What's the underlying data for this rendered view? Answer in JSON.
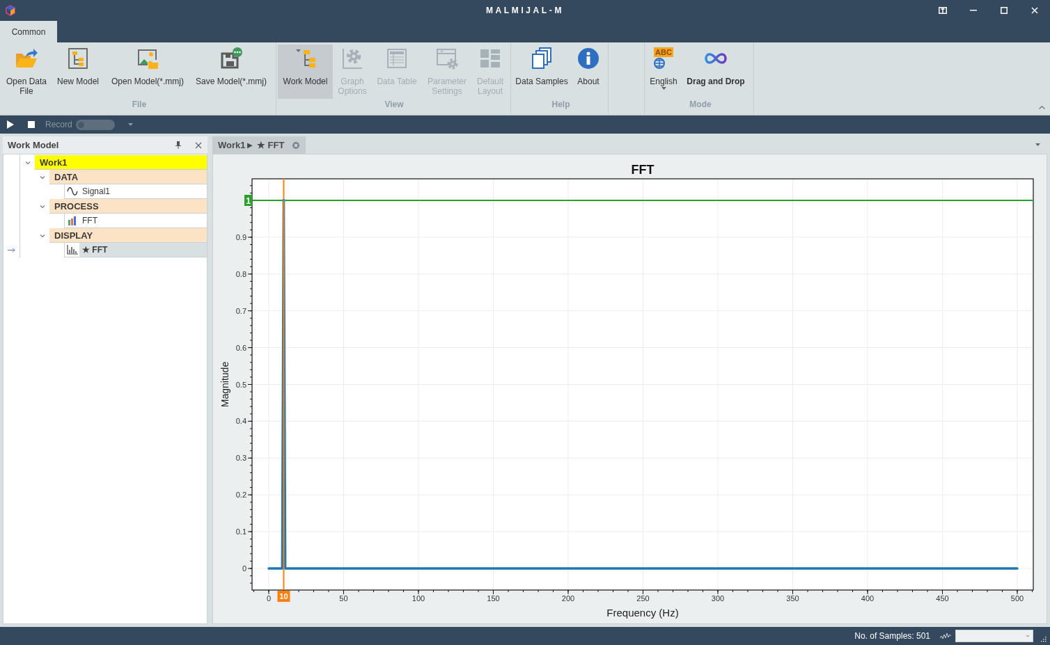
{
  "window": {
    "title": "MALMIJAL-M"
  },
  "ribbon": {
    "tabs": [
      {
        "label": "Common",
        "selected": true
      }
    ],
    "groups": [
      {
        "label": "File",
        "buttons": [
          {
            "label": "Open Data File",
            "disabled": false,
            "pressed": false,
            "active": false
          },
          {
            "label": "New Model",
            "disabled": false,
            "pressed": false,
            "active": false
          },
          {
            "label": "Open Model(*.mmj)",
            "disabled": false,
            "pressed": false,
            "active": false
          },
          {
            "label": "Save Model(*.mmj)",
            "disabled": false,
            "pressed": false,
            "active": false
          }
        ]
      },
      {
        "label": "View",
        "buttons": [
          {
            "label": "Work Model",
            "disabled": false,
            "pressed": true,
            "active": false
          },
          {
            "label": "Graph Options",
            "disabled": true,
            "pressed": false,
            "active": false
          },
          {
            "label": "Data Table",
            "disabled": true,
            "pressed": false,
            "active": false
          },
          {
            "label": "Parameter Settings",
            "disabled": true,
            "pressed": false,
            "active": false
          },
          {
            "label": "Default Layout",
            "disabled": true,
            "pressed": false,
            "active": false
          }
        ]
      },
      {
        "label": "Help",
        "buttons": [
          {
            "label": "Data Samples",
            "disabled": false,
            "pressed": false,
            "active": false
          },
          {
            "label": "About",
            "disabled": false,
            "pressed": false,
            "active": false
          }
        ]
      },
      {
        "label": "Mode",
        "buttons": [
          {
            "label": "English",
            "disabled": false,
            "pressed": false,
            "active": false,
            "badge": "ABC",
            "menu": true
          },
          {
            "label": "Drag and Drop",
            "disabled": false,
            "pressed": false,
            "active": true
          }
        ]
      }
    ]
  },
  "toolbar": {
    "record": {
      "label": "Record",
      "disabled": true
    },
    "record_toggle": {
      "on": false
    }
  },
  "work_model_panel": {
    "title": "Work Model",
    "tree": [
      {
        "label": "Work1",
        "kind": "root",
        "expanded": true,
        "selected": false,
        "children": [
          {
            "label": "DATA",
            "kind": "category",
            "expanded": true,
            "selected": false,
            "children": [
              {
                "label": "Signal1",
                "kind": "signal",
                "selected": false
              }
            ]
          },
          {
            "label": "PROCESS",
            "kind": "category",
            "expanded": true,
            "selected": false,
            "children": [
              {
                "label": "FFT",
                "kind": "process",
                "selected": false
              }
            ]
          },
          {
            "label": "DISPLAY",
            "kind": "category",
            "expanded": true,
            "selected": false,
            "children": [
              {
                "label": "★ FFT",
                "kind": "display",
                "selected": true
              }
            ]
          }
        ]
      }
    ]
  },
  "document_tabs": [
    {
      "label": "Work1► ★ FFT",
      "selected": true
    }
  ],
  "chart": {
    "chart_data": {
      "type": "line",
      "title": "FFT",
      "xlabel": "Frequency (Hz)",
      "ylabel": "Magnitude",
      "x": [
        0,
        9,
        10,
        11,
        500
      ],
      "series": [
        {
          "color": "#1f77b4",
          "values": [
            0,
            0,
            1,
            0,
            0
          ]
        }
      ],
      "xlim": [
        -11.16,
        510.7
      ],
      "ylim": [
        -0.0586,
        1.0586
      ],
      "xticks": [
        0,
        50,
        100,
        150,
        200,
        250,
        300,
        350,
        400,
        450,
        500
      ],
      "yticks": [
        0,
        0.1,
        0.2,
        0.3,
        0.4,
        0.5,
        0.6,
        0.7,
        0.8,
        0.9
      ],
      "grid": true,
      "ref_lines": [
        {
          "axis": "y",
          "value": 1,
          "label": "1",
          "color": "#2ca02c"
        },
        {
          "axis": "x",
          "value": 10,
          "label": "10",
          "color": "#ff7f0e"
        }
      ]
    }
  },
  "status_bar": {
    "samples": "No. of Samples: 501"
  }
}
